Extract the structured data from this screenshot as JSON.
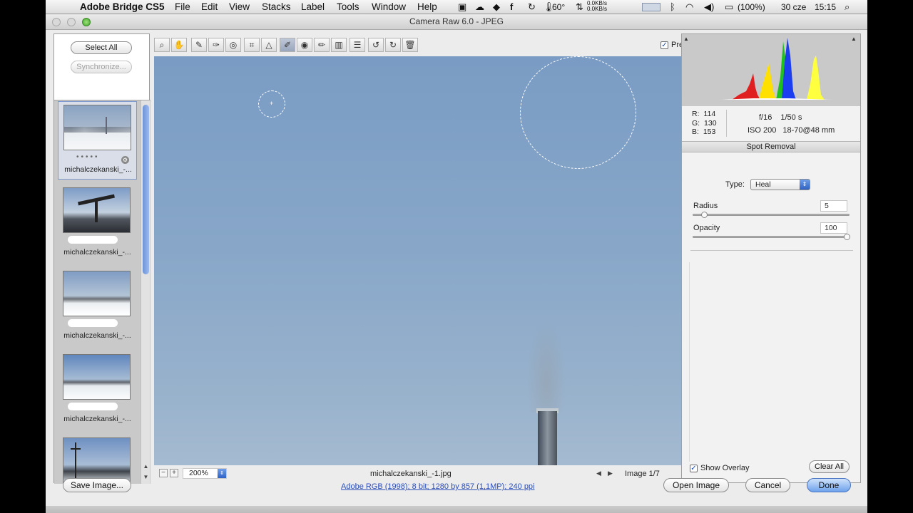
{
  "menubar": {
    "app_name": "Adobe Bridge CS5",
    "items": [
      "File",
      "Edit",
      "View",
      "Stacks",
      "Label",
      "Tools",
      "Window",
      "Help"
    ],
    "temperature": "60°",
    "net_up": "0.0KB/s",
    "net_down": "0.0KB/s",
    "battery": "(100%)",
    "date": "30 cze",
    "time": "15:15"
  },
  "window": {
    "title": "Camera Raw 6.0  -  JPEG"
  },
  "filmstrip": {
    "select_all": "Select All",
    "synchronize": "Synchronize...",
    "thumbs": [
      {
        "name": "michalczekanski_-..."
      },
      {
        "name": "michalczekanski_-..."
      },
      {
        "name": "michalczekanski_-..."
      },
      {
        "name": "michalczekanski_-..."
      },
      {
        "name": ""
      }
    ]
  },
  "toolbar": {
    "preview_label": "Preview",
    "preview_checked": true
  },
  "statusbar": {
    "zoom": "200%",
    "filename": "michalczekanski_-1.jpg",
    "image_counter": "Image 1/7"
  },
  "info": {
    "r_label": "R:",
    "r_value": "114",
    "g_label": "G:",
    "g_value": "130",
    "b_label": "B:",
    "b_value": "153",
    "aperture": "f/16",
    "shutter": "1/50 s",
    "iso": "ISO 200",
    "lens": "18-70@48 mm"
  },
  "spot_removal": {
    "title": "Spot Removal",
    "type_label": "Type:",
    "type_value": "Heal",
    "radius_label": "Radius",
    "radius_value": "5",
    "radius_fraction": 0.05,
    "opacity_label": "Opacity",
    "opacity_value": "100",
    "opacity_fraction": 1.0,
    "show_overlay_label": "Show Overlay",
    "show_overlay_checked": true,
    "clear_all": "Clear All"
  },
  "footer": {
    "save_image": "Save Image...",
    "workflow_link": "Adobe RGB (1998); 8 bit; 1280 by 857 (1,1MP); 240 ppi",
    "open_image": "Open Image",
    "cancel": "Cancel",
    "done": "Done"
  },
  "colors": {
    "sky": "#87a6c8",
    "accent": "#6ea2ec",
    "link": "#2b4eb8"
  }
}
